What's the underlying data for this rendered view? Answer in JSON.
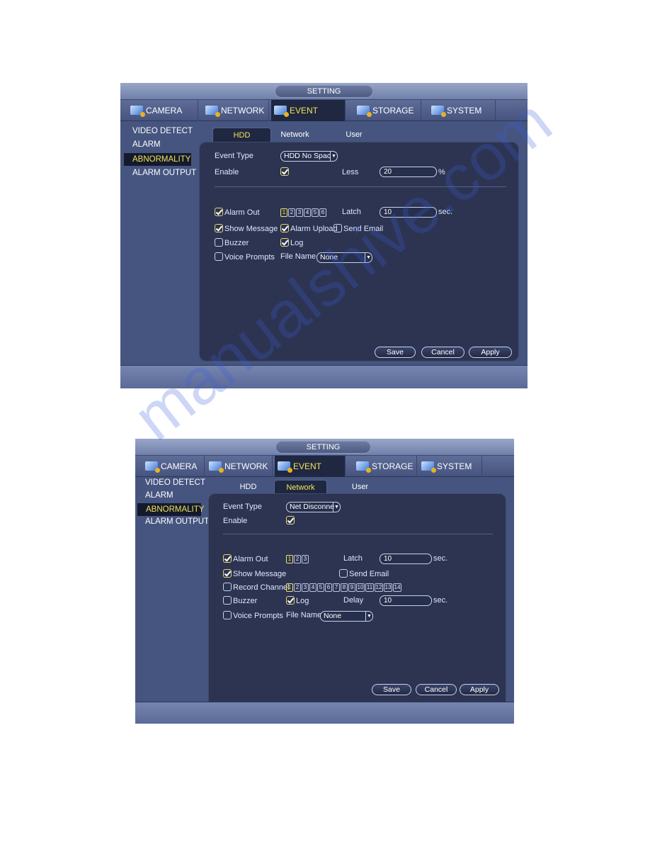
{
  "watermark": "manualshive.com",
  "screens": [
    {
      "title": "SETTING",
      "tabs": [
        {
          "label": "CAMERA",
          "icon": "camera-icon"
        },
        {
          "label": "NETWORK",
          "icon": "network-icon"
        },
        {
          "label": "EVENT",
          "icon": "event-icon",
          "active": true
        },
        {
          "label": "STORAGE",
          "icon": "storage-icon"
        },
        {
          "label": "SYSTEM",
          "icon": "system-icon"
        }
      ],
      "sidebar": [
        {
          "label": "VIDEO DETECT"
        },
        {
          "label": "ALARM"
        },
        {
          "label": "ABNORMALITY",
          "active": true
        },
        {
          "label": "ALARM OUTPUT"
        }
      ],
      "subtabs": [
        {
          "label": "HDD",
          "active": true
        },
        {
          "label": "Network"
        },
        {
          "label": "User"
        }
      ],
      "form": {
        "event_type_label": "Event Type",
        "event_type_value": "HDD No Spac",
        "enable_label": "Enable",
        "enable_checked": true,
        "less_label": "Less",
        "less_value": "20",
        "less_unit": "%",
        "alarm_out_label": "Alarm Out",
        "alarm_out_checked": true,
        "alarm_out_channels": [
          "1",
          "2",
          "3",
          "4",
          "5",
          "6"
        ],
        "alarm_out_selected": [
          "1"
        ],
        "latch_label": "Latch",
        "latch_value": "10",
        "latch_unit": "sec.",
        "show_message_label": "Show Message",
        "show_message_checked": true,
        "alarm_upload_label": "Alarm Upload",
        "alarm_upload_checked": true,
        "send_email_label": "Send Email",
        "send_email_checked": false,
        "buzzer_label": "Buzzer",
        "buzzer_checked": false,
        "log_label": "Log",
        "log_checked": true,
        "voice_prompts_label": "Voice Prompts",
        "voice_prompts_checked": false,
        "file_name_label": "File Name",
        "file_name_value": "None"
      },
      "buttons": {
        "save": "Save",
        "cancel": "Cancel",
        "apply": "Apply"
      }
    },
    {
      "title": "SETTING",
      "tabs": [
        {
          "label": "CAMERA",
          "icon": "camera-icon"
        },
        {
          "label": "NETWORK",
          "icon": "network-icon"
        },
        {
          "label": "EVENT",
          "icon": "event-icon",
          "active": true
        },
        {
          "label": "STORAGE",
          "icon": "storage-icon"
        },
        {
          "label": "SYSTEM",
          "icon": "system-icon"
        }
      ],
      "sidebar": [
        {
          "label": "VIDEO DETECT"
        },
        {
          "label": "ALARM"
        },
        {
          "label": "ABNORMALITY",
          "active": true
        },
        {
          "label": "ALARM OUTPUT"
        }
      ],
      "subtabs": [
        {
          "label": "HDD"
        },
        {
          "label": "Network",
          "active": true
        },
        {
          "label": "User"
        }
      ],
      "form": {
        "event_type_label": "Event Type",
        "event_type_value": "Net Disconne",
        "enable_label": "Enable",
        "enable_checked": true,
        "alarm_out_label": "Alarm Out",
        "alarm_out_checked": true,
        "alarm_out_channels": [
          "1",
          "2",
          "3"
        ],
        "alarm_out_selected": [
          "1"
        ],
        "latch_label": "Latch",
        "latch_value": "10",
        "latch_unit": "sec.",
        "show_message_label": "Show Message",
        "show_message_checked": true,
        "send_email_label": "Send Email",
        "send_email_checked": false,
        "record_channel_label": "Record Channel",
        "record_channel_checked": false,
        "record_channels": [
          "1",
          "2",
          "3",
          "4",
          "5",
          "6",
          "7",
          "8",
          "9",
          "10",
          "11",
          "12",
          "13",
          "14"
        ],
        "record_selected": [
          "1"
        ],
        "buzzer_label": "Buzzer",
        "buzzer_checked": false,
        "log_label": "Log",
        "log_checked": true,
        "delay_label": "Delay",
        "delay_value": "10",
        "delay_unit": "sec.",
        "voice_prompts_label": "Voice Prompts",
        "voice_prompts_checked": false,
        "file_name_label": "File Name",
        "file_name_value": "None"
      },
      "buttons": {
        "save": "Save",
        "cancel": "Cancel",
        "apply": "Apply"
      }
    }
  ]
}
